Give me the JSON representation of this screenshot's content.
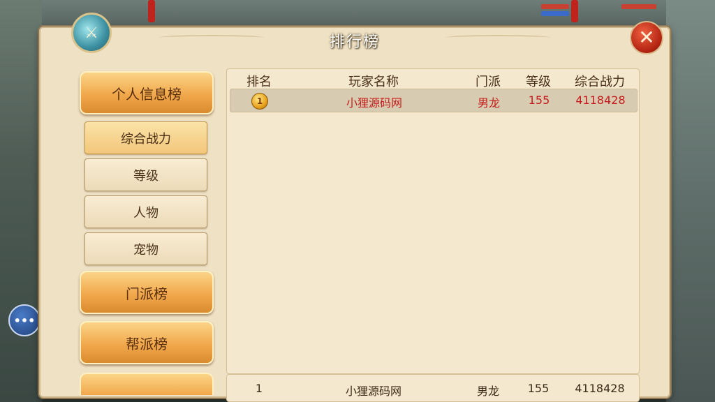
{
  "window": {
    "title": "排行榜"
  },
  "sidebar": {
    "personal": "个人信息榜",
    "sub_items": [
      {
        "label": "综合战力"
      },
      {
        "label": "等级"
      },
      {
        "label": "人物"
      },
      {
        "label": "宠物"
      }
    ],
    "sect": "门派榜",
    "guild": "帮派榜"
  },
  "table": {
    "headers": [
      "排名",
      "玩家名称",
      "门派",
      "等级",
      "综合战力"
    ],
    "rows": [
      {
        "rank_icon": "gold-medal-icon",
        "name": "小狸源码网",
        "sect": "男龙",
        "level": "155",
        "power": "4118428"
      }
    ],
    "self_row": {
      "rank": "1",
      "name": "小狸源码网",
      "sect": "男龙",
      "level": "155",
      "power": "4118428"
    }
  },
  "colors": {
    "highlight_text": "#c51b1b",
    "accent": "#f1a84c"
  }
}
